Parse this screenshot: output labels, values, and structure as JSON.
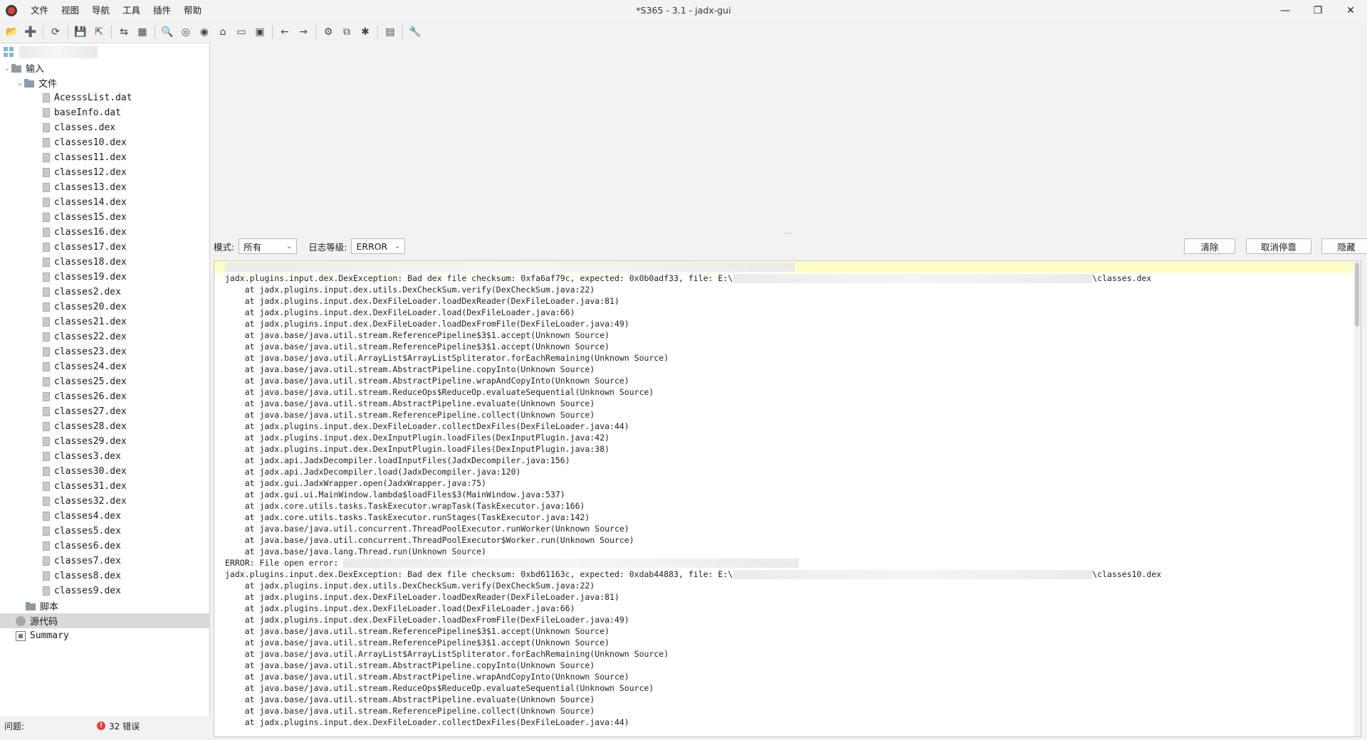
{
  "window": {
    "title": "*S365 - 3.1 - jadx-gui",
    "controls": {
      "minimize": "—",
      "restore": "❐",
      "close": "✕"
    }
  },
  "menu": [
    "文件",
    "视图",
    "导航",
    "工具",
    "插件",
    "帮助"
  ],
  "toolbar": {
    "icons": [
      "open-folder-icon",
      "add-files-icon",
      "sep",
      "reload-icon",
      "sep",
      "save-all-icon",
      "export-icon",
      "sep",
      "sync-icon",
      "flatten-packages-icon",
      "sep",
      "search-icon",
      "find-usage-icon",
      "search-class-icon",
      "home-icon",
      "log-viewer-icon",
      "plugin-icon",
      "sep",
      "back-icon",
      "forward-icon",
      "sep",
      "deobfuscation-icon",
      "quick-tabs-icon",
      "debugger-icon",
      "sep",
      "log-icon",
      "sep",
      "preferences-icon"
    ]
  },
  "tree": {
    "root_label": "输入",
    "files_folder": "文件",
    "files": [
      "AcesssList.dat",
      "baseInfo.dat",
      "classes.dex",
      "classes10.dex",
      "classes11.dex",
      "classes12.dex",
      "classes13.dex",
      "classes14.dex",
      "classes15.dex",
      "classes16.dex",
      "classes17.dex",
      "classes18.dex",
      "classes19.dex",
      "classes2.dex",
      "classes20.dex",
      "classes21.dex",
      "classes22.dex",
      "classes23.dex",
      "classes24.dex",
      "classes25.dex",
      "classes26.dex",
      "classes27.dex",
      "classes28.dex",
      "classes29.dex",
      "classes3.dex",
      "classes30.dex",
      "classes31.dex",
      "classes32.dex",
      "classes4.dex",
      "classes5.dex",
      "classes6.dex",
      "classes7.dex",
      "classes8.dex",
      "classes9.dex"
    ],
    "scripts_folder": "脚本",
    "source_label": "源代码",
    "summary_label": "Summary"
  },
  "log_controls": {
    "mode_label": "模式:",
    "mode_value": "所有",
    "level_label": "日志等级:",
    "level_value": "ERROR",
    "clear_button": "清除",
    "undock_button": "取消停靠",
    "hide_button": "隐藏"
  },
  "log_lines": [
    {
      "text": "",
      "hl": true,
      "redact_after": 0
    },
    {
      "text": "jadx.plugins.input.dex.DexException: Bad dex file checksum: 0xfa6af79c, expected: 0x0b0adf33, file: E:\\",
      "suffix": "\\classes.dex"
    },
    {
      "text": "    at jadx.plugins.input.dex.utils.DexCheckSum.verify(DexCheckSum.java:22)"
    },
    {
      "text": "    at jadx.plugins.input.dex.DexFileLoader.loadDexReader(DexFileLoader.java:81)"
    },
    {
      "text": "    at jadx.plugins.input.dex.DexFileLoader.load(DexFileLoader.java:66)"
    },
    {
      "text": "    at jadx.plugins.input.dex.DexFileLoader.loadDexFromFile(DexFileLoader.java:49)"
    },
    {
      "text": "    at java.base/java.util.stream.ReferencePipeline$3$1.accept(Unknown Source)"
    },
    {
      "text": "    at java.base/java.util.stream.ReferencePipeline$3$1.accept(Unknown Source)"
    },
    {
      "text": "    at java.base/java.util.ArrayList$ArrayListSpliterator.forEachRemaining(Unknown Source)"
    },
    {
      "text": "    at java.base/java.util.stream.AbstractPipeline.copyInto(Unknown Source)"
    },
    {
      "text": "    at java.base/java.util.stream.AbstractPipeline.wrapAndCopyInto(Unknown Source)"
    },
    {
      "text": "    at java.base/java.util.stream.ReduceOps$ReduceOp.evaluateSequential(Unknown Source)"
    },
    {
      "text": "    at java.base/java.util.stream.AbstractPipeline.evaluate(Unknown Source)"
    },
    {
      "text": "    at java.base/java.util.stream.ReferencePipeline.collect(Unknown Source)"
    },
    {
      "text": "    at jadx.plugins.input.dex.DexFileLoader.collectDexFiles(DexFileLoader.java:44)"
    },
    {
      "text": "    at jadx.plugins.input.dex.DexInputPlugin.loadFiles(DexInputPlugin.java:42)"
    },
    {
      "text": "    at jadx.plugins.input.dex.DexInputPlugin.loadFiles(DexInputPlugin.java:38)"
    },
    {
      "text": "    at jadx.api.JadxDecompiler.loadInputFiles(JadxDecompiler.java:156)"
    },
    {
      "text": "    at jadx.api.JadxDecompiler.load(JadxDecompiler.java:120)"
    },
    {
      "text": "    at jadx.gui.JadxWrapper.open(JadxWrapper.java:75)"
    },
    {
      "text": "    at jadx.gui.ui.MainWindow.lambda$loadFiles$3(MainWindow.java:537)"
    },
    {
      "text": "    at jadx.core.utils.tasks.TaskExecutor.wrapTask(TaskExecutor.java:166)"
    },
    {
      "text": "    at jadx.core.utils.tasks.TaskExecutor.runStages(TaskExecutor.java:142)"
    },
    {
      "text": "    at java.base/java.util.concurrent.ThreadPoolExecutor.runWorker(Unknown Source)"
    },
    {
      "text": "    at java.base/java.util.concurrent.ThreadPoolExecutor$Worker.run(Unknown Source)"
    },
    {
      "text": "    at java.base/java.lang.Thread.run(Unknown Source)"
    },
    {
      "text": "ERROR: File open error: ",
      "redact_after": 1
    },
    {
      "text": "jadx.plugins.input.dex.DexException: Bad dex file checksum: 0xbd61163c, expected: 0xdab44883, file: E:\\",
      "suffix": "\\classes10.dex"
    },
    {
      "text": "    at jadx.plugins.input.dex.utils.DexCheckSum.verify(DexCheckSum.java:22)"
    },
    {
      "text": "    at jadx.plugins.input.dex.DexFileLoader.loadDexReader(DexFileLoader.java:81)"
    },
    {
      "text": "    at jadx.plugins.input.dex.DexFileLoader.load(DexFileLoader.java:66)"
    },
    {
      "text": "    at jadx.plugins.input.dex.DexFileLoader.loadDexFromFile(DexFileLoader.java:49)"
    },
    {
      "text": "    at java.base/java.util.stream.ReferencePipeline$3$1.accept(Unknown Source)"
    },
    {
      "text": "    at java.base/java.util.stream.ReferencePipeline$3$1.accept(Unknown Source)"
    },
    {
      "text": "    at java.base/java.util.ArrayList$ArrayListSpliterator.forEachRemaining(Unknown Source)"
    },
    {
      "text": "    at java.base/java.util.stream.AbstractPipeline.copyInto(Unknown Source)"
    },
    {
      "text": "    at java.base/java.util.stream.AbstractPipeline.wrapAndCopyInto(Unknown Source)"
    },
    {
      "text": "    at java.base/java.util.stream.ReduceOps$ReduceOp.evaluateSequential(Unknown Source)"
    },
    {
      "text": "    at java.base/java.util.stream.AbstractPipeline.evaluate(Unknown Source)"
    },
    {
      "text": "    at java.base/java.util.stream.ReferencePipeline.collect(Unknown Source)"
    },
    {
      "text": "    at jadx.plugins.input.dex.DexFileLoader.collectDexFiles(DexFileLoader.java:44)"
    }
  ],
  "status": {
    "issues_label": "问题:",
    "error_count": "32 错误"
  },
  "colors": {
    "error_red": "#e0413a",
    "highlight_yellow": "#fefcc8",
    "selected_row": "#d9d9d9"
  }
}
